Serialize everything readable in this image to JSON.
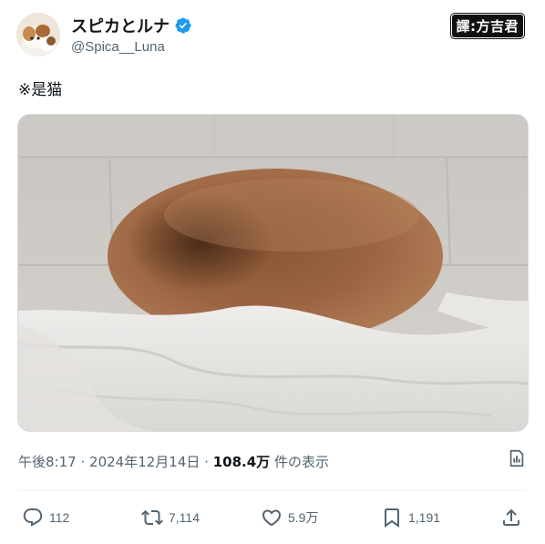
{
  "author": {
    "display_name": "スピカとルナ",
    "handle": "@Spica__Luna",
    "verified": true
  },
  "translator_badge": {
    "label": "譯:方吉君"
  },
  "tweet": {
    "text": "※是猫"
  },
  "meta": {
    "time": "午後8:17",
    "separator": "·",
    "date": "2024年12月14日",
    "views_count": "108.4万",
    "views_label": "件の表示"
  },
  "actions": {
    "replies": "112",
    "retweets": "7,114",
    "likes": "5.9万",
    "bookmarks": "1,191"
  },
  "icons": {
    "verified": "verified-badge-icon",
    "analytics": "analytics-icon",
    "reply": "reply-icon",
    "retweet": "retweet-icon",
    "like": "heart-icon",
    "bookmark": "bookmark-icon",
    "share": "share-icon"
  },
  "colors": {
    "verified_blue": "#1d9bf0",
    "muted_text": "#536471",
    "primary_text": "#0f1419"
  }
}
